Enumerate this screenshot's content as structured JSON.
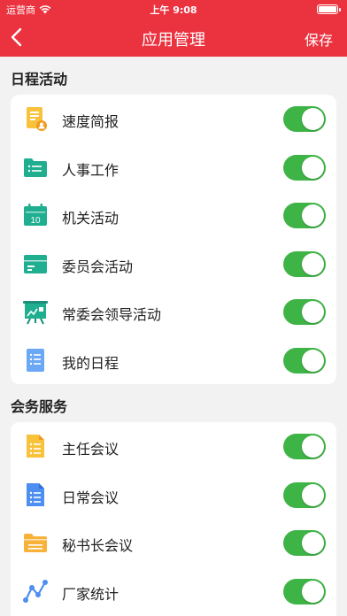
{
  "status_bar": {
    "carrier": "运营商",
    "time": "上午 9:08"
  },
  "nav": {
    "title": "应用管理",
    "save_label": "保存"
  },
  "sections": [
    {
      "title": "日程活动",
      "items": [
        {
          "label": "速度简报",
          "icon": "report-icon",
          "enabled": true
        },
        {
          "label": "人事工作",
          "icon": "folder-icon",
          "enabled": true
        },
        {
          "label": "机关活动",
          "icon": "calendar-icon",
          "enabled": true
        },
        {
          "label": "委员会活动",
          "icon": "folder-icon",
          "enabled": true
        },
        {
          "label": "常委会领导活动",
          "icon": "presentation-icon",
          "enabled": true
        },
        {
          "label": "我的日程",
          "icon": "list-icon",
          "enabled": true
        }
      ]
    },
    {
      "title": "会务服务",
      "items": [
        {
          "label": "主任会议",
          "icon": "document-icon",
          "enabled": true
        },
        {
          "label": "日常会议",
          "icon": "document-icon",
          "enabled": true
        },
        {
          "label": "秘书长会议",
          "icon": "folder-icon",
          "enabled": true
        },
        {
          "label": "厂家统计",
          "icon": "chart-icon",
          "enabled": true
        }
      ]
    }
  ],
  "colors": {
    "accent": "#eb3340",
    "toggle_on": "#3fb446"
  },
  "calendar_icon_number": "10"
}
